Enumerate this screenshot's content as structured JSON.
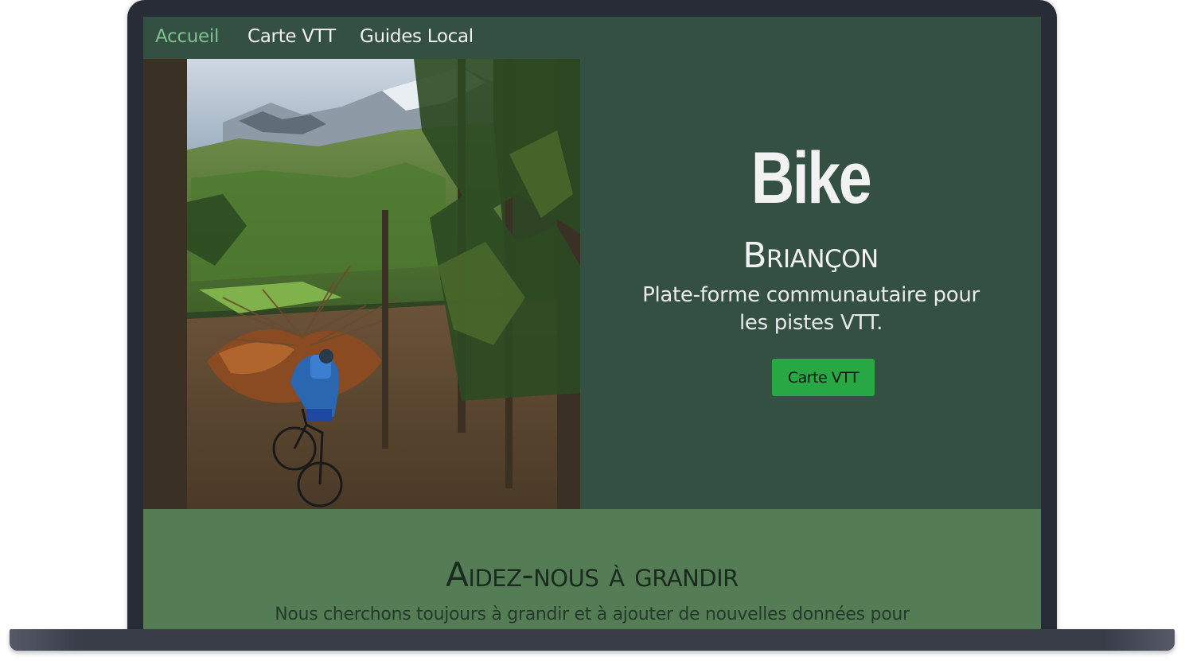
{
  "nav": {
    "items": [
      {
        "label": "Accueil",
        "active": true
      },
      {
        "label": "Carte VTT",
        "active": false
      },
      {
        "label": "Guides Local",
        "active": false
      }
    ],
    "active_color": "#7ec08f"
  },
  "hero": {
    "image_icon": "mountain-biker-forest-photo",
    "brand": "Bike",
    "city": "Briançon",
    "tagline": "Plate-forme communautaire pour les pistes VTT.",
    "cta_label": "Carte VTT",
    "cta_color": "#28a745",
    "background_color": "#335042"
  },
  "section2": {
    "title": "Aidez-nous à grandir",
    "text": "Nous cherchons toujours à grandir et à ajouter de nouvelles données pour",
    "background_color": "#557d55"
  }
}
